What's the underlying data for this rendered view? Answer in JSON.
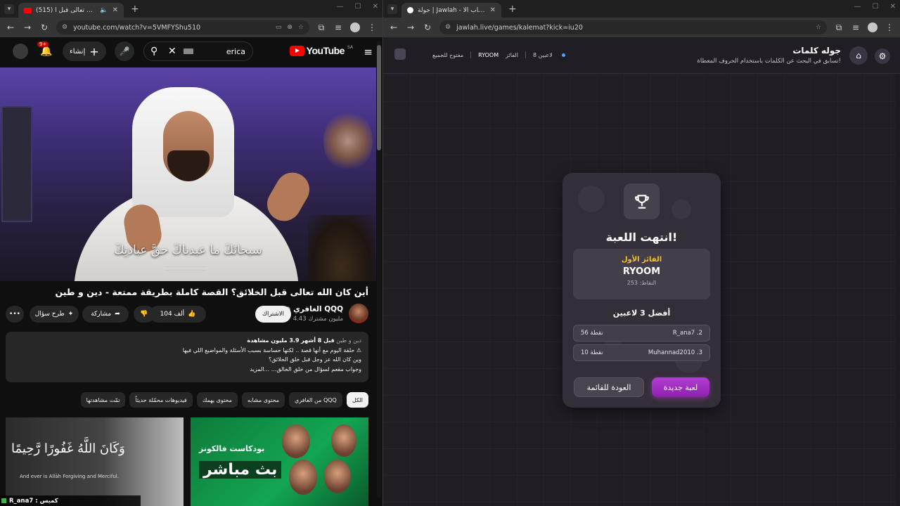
{
  "left_browser": {
    "tab_title": "(515) أين كان الله تعالى قبل ا...",
    "url": "youtube.com/watch?v=5VMFYShu510",
    "youtube": {
      "logo_text": "YouTube",
      "logo_region": "SA",
      "search_query": "erica",
      "notifications_badge": "9+",
      "create_label": "إنشاء",
      "video_caption": "سبحانَكَ ما عبدناكَ حقَّ عبادتِكَ",
      "video_title": "أين كان الله تعالى قبل الخلائق؟ القصة كاملة بطريقة ممتعة - دين و طين",
      "channel_name": "الغافري QQQ",
      "channel_subs": "4.43 مليون مشترك",
      "subscribe_label": "الاشتراك",
      "likes": "104 ألف",
      "share_label": "مشاركة",
      "ask_label": "طرح سؤال",
      "description": {
        "views": "3.9 مليون مشاهدة",
        "time": "قبل 8 أشهر",
        "tags": "دين و طين",
        "line1": "حلقة اليوم مع أنها قصة .. لكنها حساسة بسبب الأسئلة والمواضيع اللي فيها ⚠",
        "line2": "وين كان الله عز وجل قبل خلق الخلائق؟",
        "line3": "وجواب مقعم لسؤال من خلق الخالق...",
        "more": "...المزيد"
      },
      "chips": [
        "الكل",
        "من الغافري QQQ",
        "محتوى مشابه",
        "محتوى يهمك",
        "فيديوهات محمّلة حديثاً",
        "تمّت مشاهدتها"
      ],
      "thumb1": {
        "arabic": "وَكَانَ اللَّهُ غَفُورًا رَّحِيمًا",
        "english": "And ever is Allāh Forgiving and Merciful."
      },
      "thumb2": {
        "line1": "بودكاست فالكونز",
        "line2": "بث مباشر"
      },
      "chat_overlay": "R_ana7 : كميس"
    }
  },
  "right_browser": {
    "tab_title": "جولة | Jawlah - منصة الألعاب الا...",
    "url": "jawlah.live/games/kalemat?kick=iu20",
    "header": {
      "title": "جوله كلمات",
      "subtitle": "تسابق في البحث عن الكلمات باستخدام الحروف المعطاة!",
      "players": "8 لاعبين",
      "winner_label": "الفائز",
      "winner_name": "RYOOM",
      "mode": "مفتوح للجميع"
    },
    "card": {
      "title": "انتهت اللعبة!",
      "first_place_label": "الفائز الأول",
      "winner_name": "RYOOM",
      "winner_points": "النقاط: 253",
      "top_label": "أفضل 3 لاعبين",
      "rows": [
        {
          "rank_name": "R_ana7 .2",
          "points": "56 نقطة"
        },
        {
          "rank_name": "Muhannad2010 .3",
          "points": "10 نقطة"
        }
      ],
      "new_game_label": "لعبة جديدة",
      "back_label": "العودة للقائمة"
    }
  }
}
